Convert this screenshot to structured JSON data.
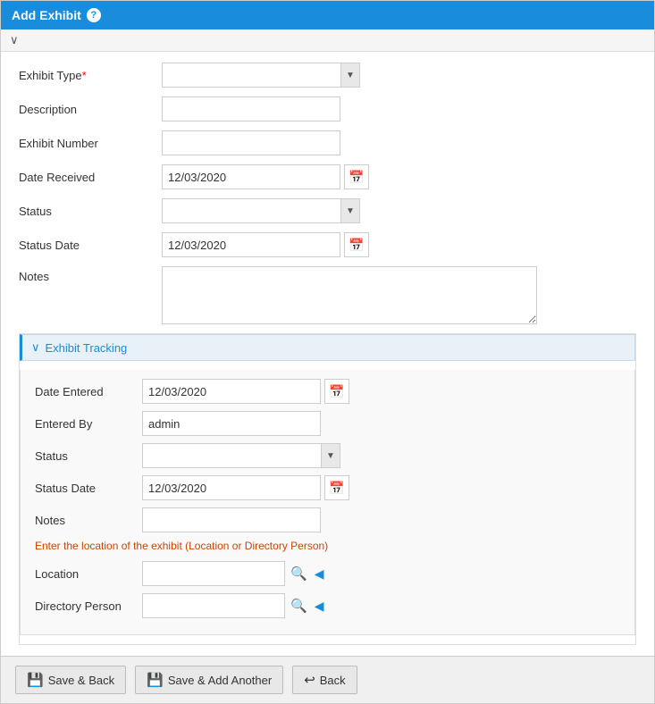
{
  "title": "Add Exhibit",
  "help_icon": "?",
  "collapse_bar": "∨",
  "form": {
    "exhibit_type_label": "Exhibit Type",
    "exhibit_type_required": "*",
    "exhibit_type_value": "",
    "description_label": "Description",
    "description_value": "",
    "exhibit_number_label": "Exhibit Number",
    "exhibit_number_value": "",
    "date_received_label": "Date Received",
    "date_received_value": "12/03/2020",
    "status_label": "Status",
    "status_value": "",
    "status_date_label": "Status Date",
    "status_date_value": "12/03/2020",
    "notes_label": "Notes",
    "notes_value": ""
  },
  "tracking": {
    "section_label": "Exhibit Tracking",
    "date_entered_label": "Date Entered",
    "date_entered_value": "12/03/2020",
    "entered_by_label": "Entered By",
    "entered_by_value": "admin",
    "status_label": "Status",
    "status_value": "",
    "status_date_label": "Status Date",
    "status_date_value": "12/03/2020",
    "notes_label": "Notes",
    "notes_value": "",
    "info_text": "Enter the location of the exhibit (Location or Directory Person)",
    "location_label": "Location",
    "location_value": "",
    "directory_person_label": "Directory Person",
    "directory_person_value": ""
  },
  "footer": {
    "save_back_label": "Save & Back",
    "save_add_label": "Save & Add Another",
    "back_label": "Back"
  },
  "icons": {
    "calendar": "📅",
    "save_back_icon": "💾",
    "save_add_icon": "💾",
    "back_icon": "↩",
    "search_icon": "🔍",
    "clear_icon": "◀"
  }
}
